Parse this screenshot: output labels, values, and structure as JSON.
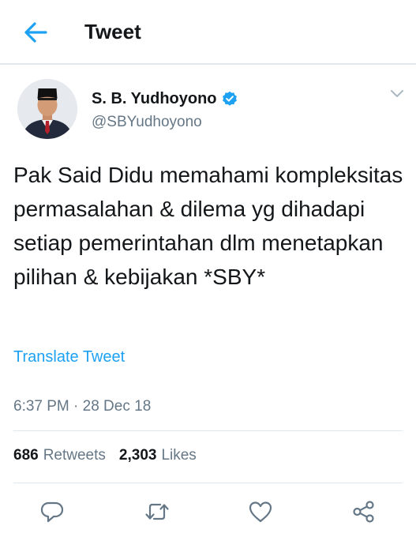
{
  "header": {
    "title": "Tweet",
    "back_icon": "arrow-left-icon",
    "accent_color": "#1da1f2"
  },
  "tweet": {
    "author": {
      "display_name": "S. B. Yudhoyono",
      "handle": "@SBYudhoyono",
      "verified": true
    },
    "text": "Pak Said Didu memahami kompleksitas permasalahan & dilema yg dihadapi setiap pemerintahan dlm menetapkan pilihan & kebijakan *SBY*",
    "translate_label": "Translate Tweet",
    "timestamp": "6:37 PM · 28 Dec 18",
    "stats": {
      "retweets_count": "686",
      "retweets_label": "Retweets",
      "likes_count": "2,303",
      "likes_label": "Likes"
    }
  },
  "actions": [
    {
      "name": "reply",
      "icon": "reply-icon"
    },
    {
      "name": "retweet",
      "icon": "retweet-icon"
    },
    {
      "name": "like",
      "icon": "heart-icon"
    },
    {
      "name": "share",
      "icon": "share-icon"
    }
  ]
}
